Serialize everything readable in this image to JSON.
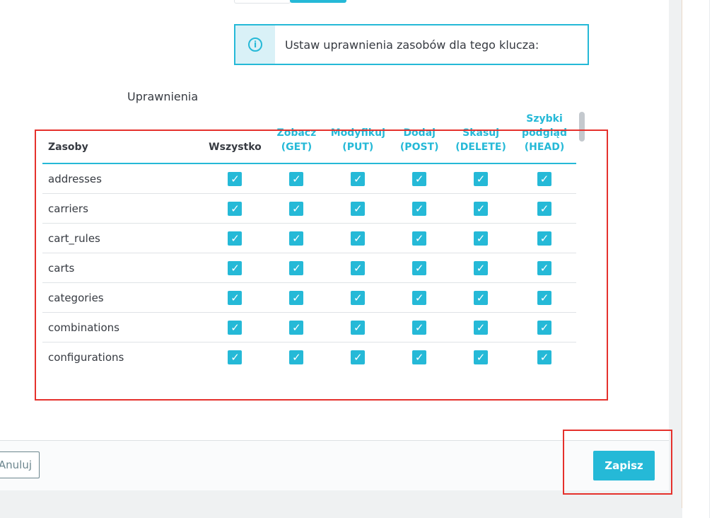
{
  "info": {
    "icon": "info-icon",
    "text": "Ustaw uprawnienia zasobów dla tego klucza:"
  },
  "permissions_label": "Uprawnienia",
  "table": {
    "headers": {
      "resource": "Zasoby",
      "all": "Wszystko",
      "get": [
        "Zobacz",
        "(GET)"
      ],
      "put": [
        "Modyfikuj",
        "(PUT)"
      ],
      "post": [
        "Dodaj",
        "(POST)"
      ],
      "delete": [
        "Skasuj",
        "(DELETE)"
      ],
      "head": [
        "Szybki",
        "podgląd",
        "(HEAD)"
      ]
    },
    "rows": [
      {
        "name": "addresses"
      },
      {
        "name": "carriers"
      },
      {
        "name": "cart_rules"
      },
      {
        "name": "carts"
      },
      {
        "name": "categories"
      },
      {
        "name": "combinations"
      },
      {
        "name": "configurations"
      }
    ],
    "check_glyph": "✓"
  },
  "footer": {
    "cancel_label": "Anuluj",
    "save_label": "Zapisz"
  },
  "colors": {
    "accent": "#25b9d7",
    "highlight": "#e5312c"
  }
}
